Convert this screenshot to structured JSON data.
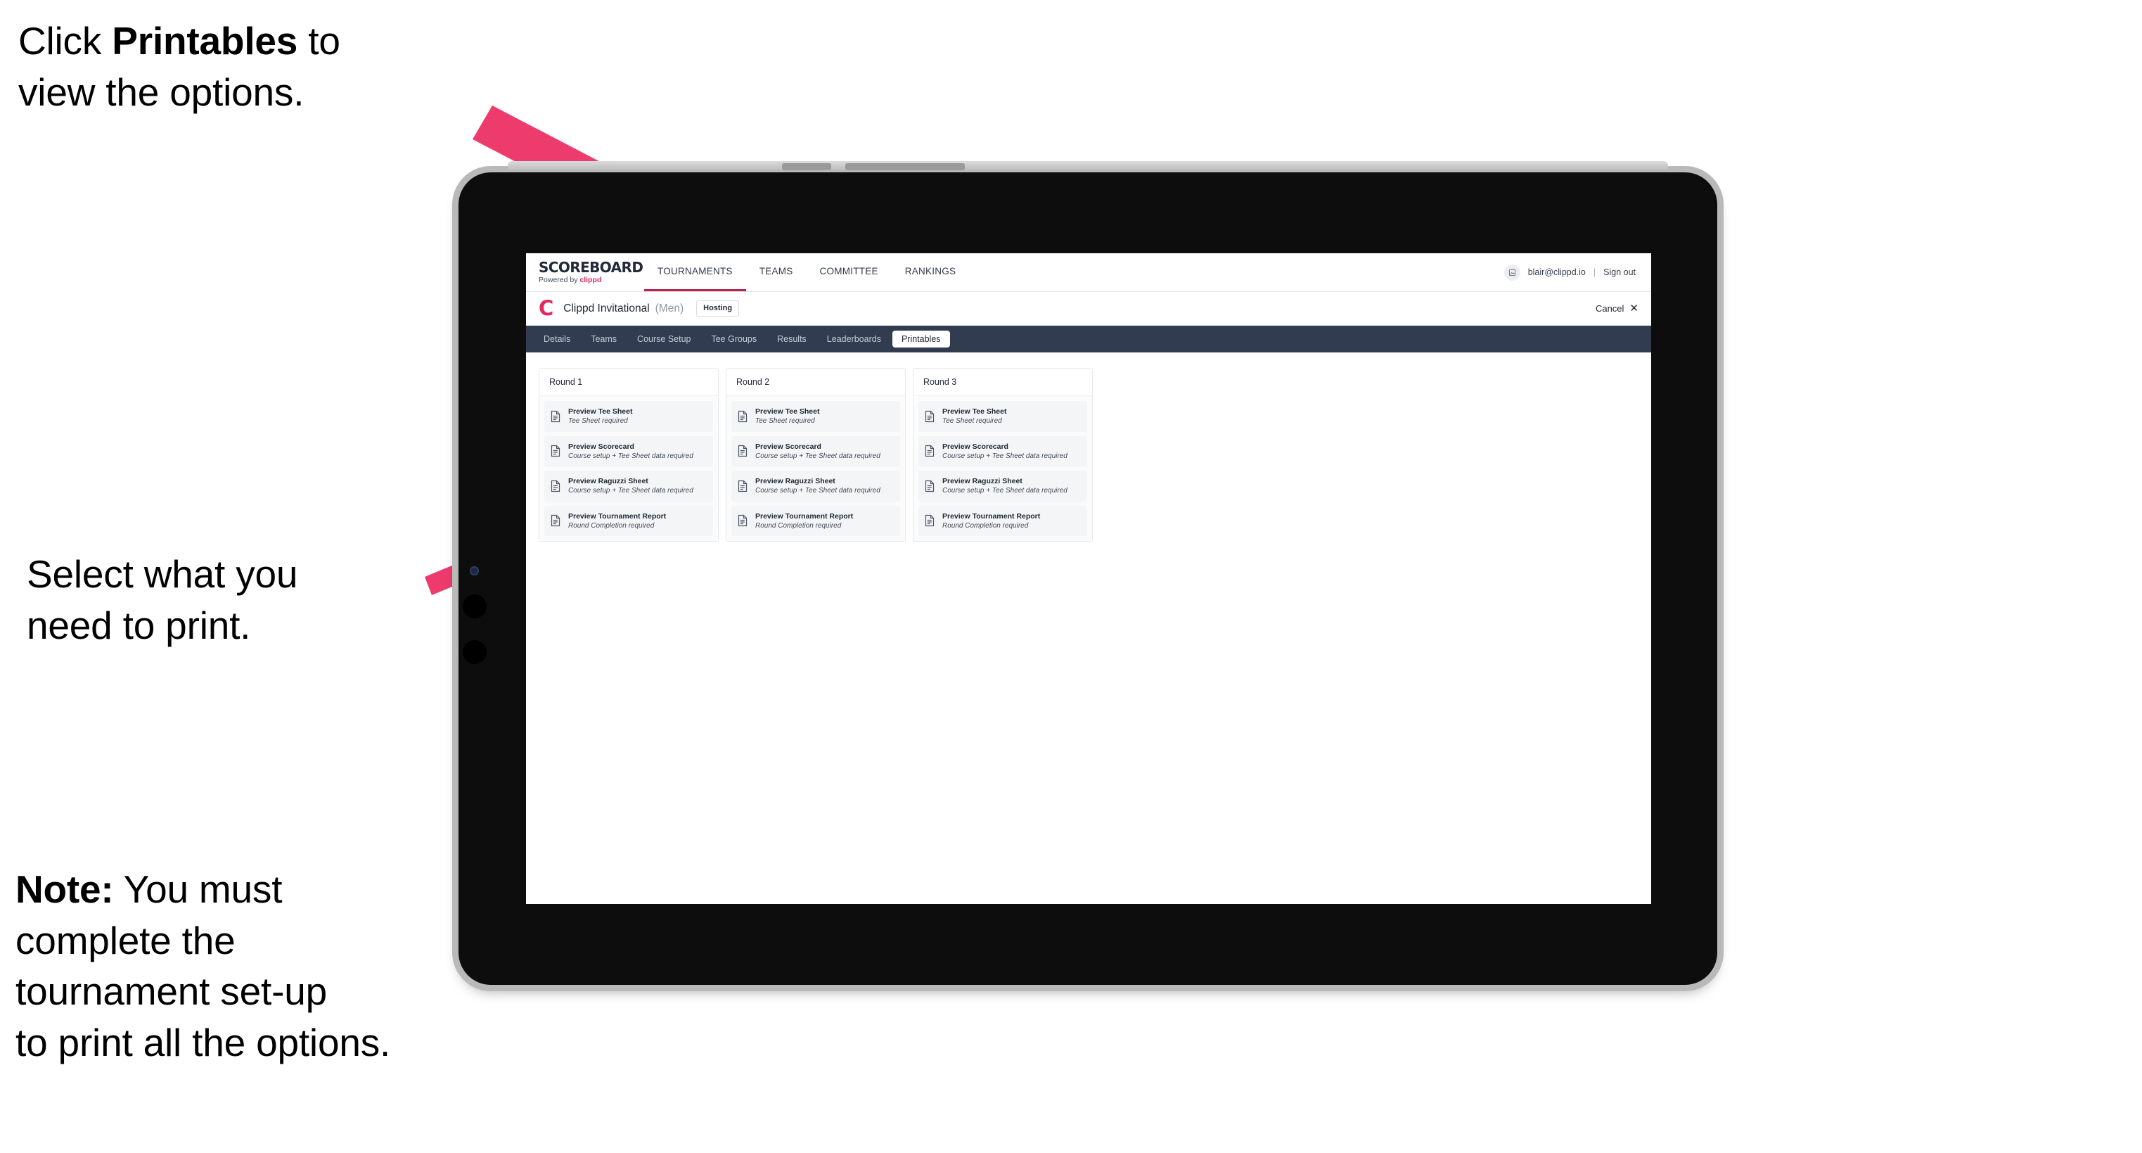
{
  "annotations": [
    {
      "id": "annot-1",
      "text_plain": "Click Printables to\nview the options.",
      "bold_word": "Printables"
    },
    {
      "id": "annot-2",
      "text_plain": "Select what you\n need to print."
    },
    {
      "id": "annot-3",
      "text_plain": "Note: You must\ncomplete the\ntournament set-up\nto print all the options.",
      "bold_word": "Note:"
    }
  ],
  "annotation_1": {
    "pre": "Click ",
    "bold": "Printables",
    "post": " to\nview the options."
  },
  "annotation_2": {
    "line1": "Select what you",
    "line2": " need to print."
  },
  "annotation_3": {
    "bold": "Note:",
    "rest": " You must\ncomplete the\ntournament set-up\nto print all the options."
  },
  "colors": {
    "arrow_pink": "#ee3b6e",
    "navy_tabbar": "#323c50",
    "brand_red": "#e0295c",
    "active_underline": "#b9244c",
    "bezel_black": "#0d0d0d",
    "bezel_outer": "#b9b9b9"
  },
  "topbar": {
    "brand_title": "SCOREBOARD",
    "brand_sub_prefix": "Powered by ",
    "brand_sub_name": "clippd",
    "nav": [
      {
        "label": "TOURNAMENTS",
        "active": true
      },
      {
        "label": "TEAMS",
        "active": false
      },
      {
        "label": "COMMITTEE",
        "active": false
      },
      {
        "label": "RANKINGS",
        "active": false
      }
    ],
    "avatar_icon": "user-avatar-icon",
    "user_email": "blair@clippd.io",
    "divider": "|",
    "signout_label": "Sign out"
  },
  "tournament_bar": {
    "logo_letter": "C",
    "name": "Clippd Invitational",
    "gender": "(Men)",
    "status_badge": "Hosting",
    "cancel_label": "Cancel",
    "cancel_icon": "close-x-icon"
  },
  "tabs": [
    {
      "label": "Details",
      "active": false
    },
    {
      "label": "Teams",
      "active": false
    },
    {
      "label": "Course Setup",
      "active": false
    },
    {
      "label": "Tee Groups",
      "active": false
    },
    {
      "label": "Results",
      "active": false
    },
    {
      "label": "Leaderboards",
      "active": false
    },
    {
      "label": "Printables",
      "active": true
    }
  ],
  "rounds": [
    {
      "title": "Round 1",
      "items": [
        {
          "title": "Preview Tee Sheet",
          "requirement": "Tee Sheet required"
        },
        {
          "title": "Preview Scorecard",
          "requirement": "Course setup + Tee Sheet data required"
        },
        {
          "title": "Preview Raguzzi Sheet",
          "requirement": "Course setup + Tee Sheet data required"
        },
        {
          "title": "Preview Tournament Report",
          "requirement": "Round Completion required"
        }
      ]
    },
    {
      "title": "Round 2",
      "items": [
        {
          "title": "Preview Tee Sheet",
          "requirement": "Tee Sheet required"
        },
        {
          "title": "Preview Scorecard",
          "requirement": "Course setup + Tee Sheet data required"
        },
        {
          "title": "Preview Raguzzi Sheet",
          "requirement": "Course setup + Tee Sheet data required"
        },
        {
          "title": "Preview Tournament Report",
          "requirement": "Round Completion required"
        }
      ]
    },
    {
      "title": "Round 3",
      "items": [
        {
          "title": "Preview Tee Sheet",
          "requirement": "Tee Sheet required"
        },
        {
          "title": "Preview Scorecard",
          "requirement": "Course setup + Tee Sheet data required"
        },
        {
          "title": "Preview Raguzzi Sheet",
          "requirement": "Course setup + Tee Sheet data required"
        },
        {
          "title": "Preview Tournament Report",
          "requirement": "Round Completion required"
        }
      ]
    }
  ]
}
